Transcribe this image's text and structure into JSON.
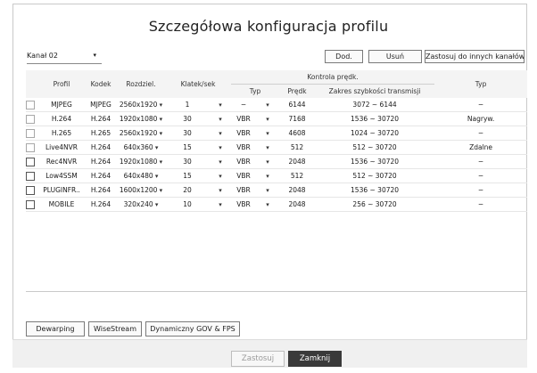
{
  "dialog": {
    "title": "Szczegółowa konfiguracja profilu"
  },
  "channel": {
    "value": "Kanał 02",
    "arrow": "▾"
  },
  "toolbar": {
    "add_label": "Dod.",
    "delete_label": "Usuń",
    "apply_other_label": "Zastosuj do innych kanałów"
  },
  "table": {
    "group_header": "Kontrola prędk.",
    "headers": {
      "profile": "Profil",
      "codec": "Kodek",
      "resolution": "Rozdziel.",
      "fps": "Klatek/sek",
      "type": "Typ",
      "rate": "Prędk",
      "range": "Zakres szybkości transmisji",
      "type2": "Typ"
    },
    "rows": [
      {
        "profile": "MJPEG",
        "codec": "MJPEG",
        "resolution": "2560x1920",
        "fps": "1",
        "type": "−",
        "rate": "6144",
        "range": "3072 ~ 6144",
        "type2": "−",
        "checkbox_style": "light"
      },
      {
        "profile": "H.264",
        "codec": "H.264",
        "resolution": "1920x1080",
        "fps": "30",
        "type": "VBR",
        "rate": "7168",
        "range": "1536 ~ 30720",
        "type2": "Nagryw.",
        "checkbox_style": "light"
      },
      {
        "profile": "H.265",
        "codec": "H.265",
        "resolution": "2560x1920",
        "fps": "30",
        "type": "VBR",
        "rate": "4608",
        "range": "1024 ~ 30720",
        "type2": "−",
        "checkbox_style": "light"
      },
      {
        "profile": "Live4NVR",
        "codec": "H.264",
        "resolution": "640x360",
        "fps": "15",
        "type": "VBR",
        "rate": "512",
        "range": "512 ~ 30720",
        "type2": "Zdalne",
        "checkbox_style": "light"
      },
      {
        "profile": "Rec4NVR",
        "codec": "H.264",
        "resolution": "1920x1080",
        "fps": "30",
        "type": "VBR",
        "rate": "2048",
        "range": "1536 ~ 30720",
        "type2": "−",
        "checkbox_style": "dark"
      },
      {
        "profile": "Low4SSM",
        "codec": "H.264",
        "resolution": "640x480",
        "fps": "15",
        "type": "VBR",
        "rate": "512",
        "range": "512 ~ 30720",
        "type2": "−",
        "checkbox_style": "dark"
      },
      {
        "profile": "PLUGINFR..",
        "codec": "H.264",
        "resolution": "1600x1200",
        "fps": "20",
        "type": "VBR",
        "rate": "2048",
        "range": "1536 ~ 30720",
        "type2": "−",
        "checkbox_style": "dark"
      },
      {
        "profile": "MOBILE",
        "codec": "H.264",
        "resolution": "320x240",
        "fps": "10",
        "type": "VBR",
        "rate": "2048",
        "range": "256 ~ 30720",
        "type2": "−",
        "checkbox_style": "dark"
      }
    ]
  },
  "bottom_buttons": {
    "dewarping": "Dewarping",
    "wisestream": "WiseStream",
    "dynamic_gov": "Dynamiczny GOV & FPS"
  },
  "footer": {
    "apply": "Zastosuj",
    "close": "Zamknij"
  },
  "colors": {
    "close_bg": "#3a3a3a",
    "border": "#c9c9c9",
    "footer_bg": "#f0f0f0"
  }
}
